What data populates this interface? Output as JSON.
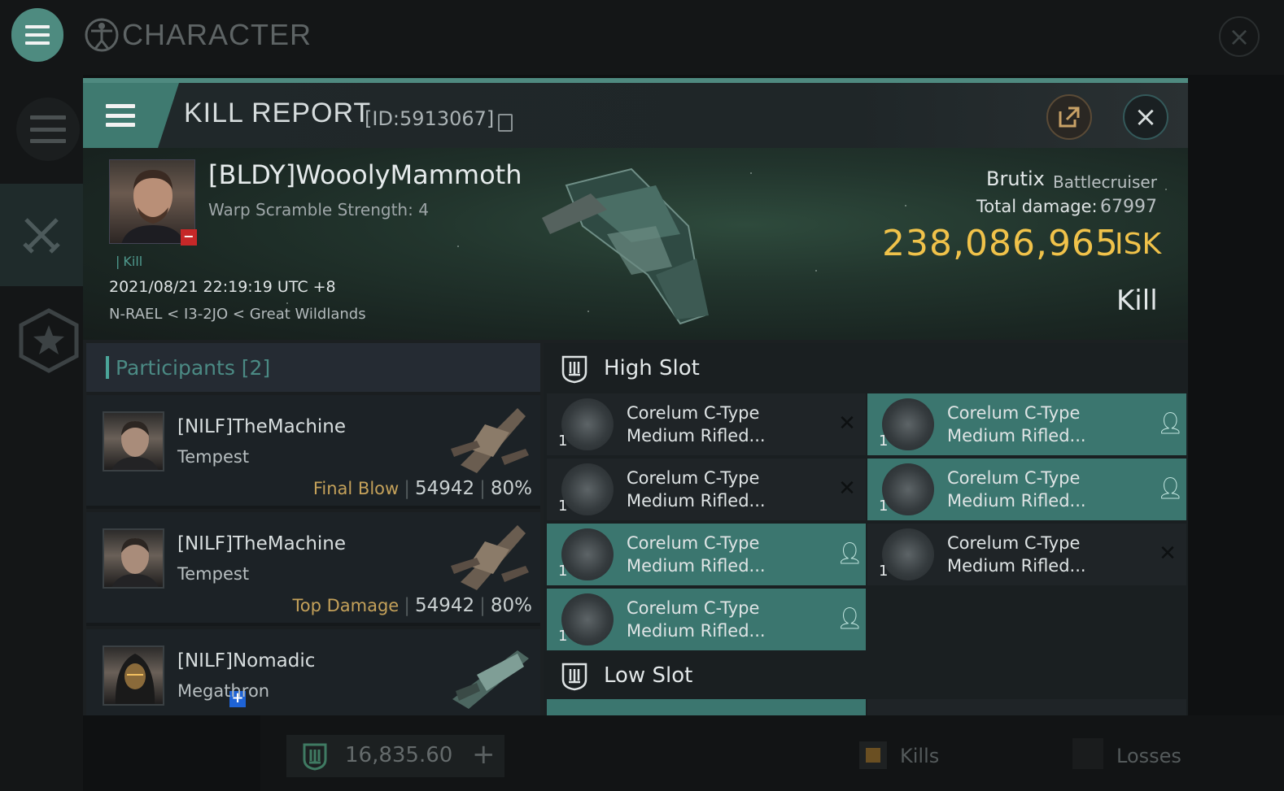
{
  "app": {
    "title": "CHARACTER",
    "isk_balance": "16,835.60",
    "tabs": {
      "kills": "Kills",
      "losses": "Losses"
    }
  },
  "report": {
    "title": "KILL REPORT",
    "id_label": "[ID:5913067]",
    "victim": {
      "name": "[BLDY]WooolyMammoth",
      "scram": "Warp Scramble Strength: 4",
      "tag": "Kill",
      "time": "2021/08/21 22:19:19 UTC +8",
      "location": "N-RAEL < I3-2JO < Great Wildlands"
    },
    "ship": {
      "name": "Brutix",
      "class": "Battlecruiser"
    },
    "damage_label": "Total damage:",
    "damage_value": "67997",
    "isk_value": "238,086,965",
    "isk_unit": "ISK",
    "result": "Kill"
  },
  "participants": {
    "title": "Participants [2]",
    "rows": [
      {
        "name": "[NILF]TheMachine",
        "ship": "Tempest",
        "tag": "Final Blow",
        "damage": "54942",
        "percent": "80%"
      },
      {
        "name": "[NILF]TheMachine",
        "ship": "Tempest",
        "tag": "Top Damage",
        "damage": "54942",
        "percent": "80%"
      },
      {
        "name": "[NILF]Nomadic",
        "ship": "Megathron",
        "tag": "",
        "damage": "",
        "percent": ""
      }
    ]
  },
  "fittings": {
    "high_slot_title": "High Slot",
    "low_slot_title": "Low Slot",
    "modules": [
      {
        "qty": "1",
        "line1": "Corelum C-Type",
        "line2": "Medium Rifled...",
        "status": "destroyed"
      },
      {
        "qty": "1",
        "line1": "Corelum C-Type",
        "line2": "Medium Rifled...",
        "status": "dropped"
      },
      {
        "qty": "1",
        "line1": "Corelum C-Type",
        "line2": "Medium Rifled...",
        "status": "destroyed"
      },
      {
        "qty": "1",
        "line1": "Corelum C-Type",
        "line2": "Medium Rifled...",
        "status": "dropped"
      },
      {
        "qty": "1",
        "line1": "Corelum C-Type",
        "line2": "Medium Rifled...",
        "status": "dropped"
      },
      {
        "qty": "1",
        "line1": "Corelum C-Type",
        "line2": "Medium Rifled...",
        "status": "destroyed"
      },
      {
        "qty": "1",
        "line1": "Corelum C-Type",
        "line2": "Medium Rifled...",
        "status": "dropped"
      }
    ]
  },
  "colors": {
    "accent": "#4f8a80",
    "isk": "#f0c24a",
    "dropped": "#3b766f",
    "tag": "#c4a15a"
  }
}
